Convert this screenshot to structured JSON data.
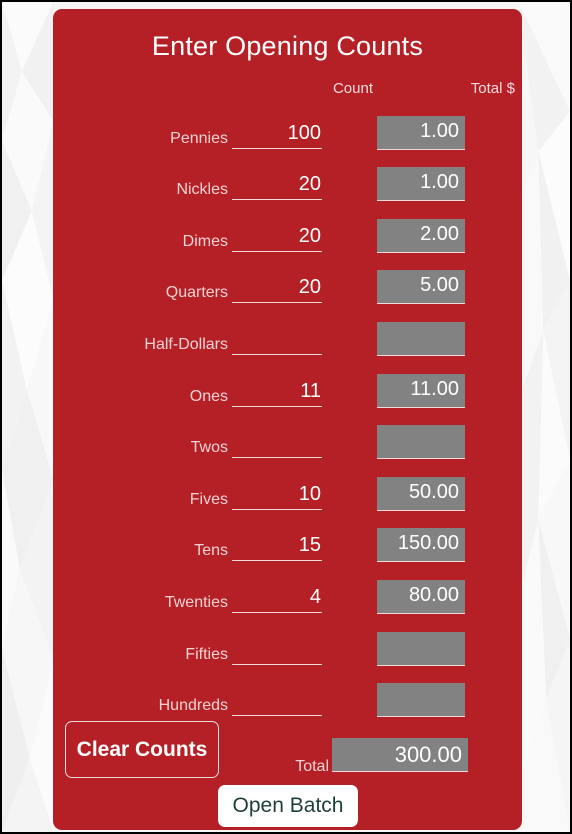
{
  "window": {
    "background_color": "#f7f7f7",
    "border_color": "#000000"
  },
  "card": {
    "background_color": "#b52026",
    "title": "Enter Opening Counts"
  },
  "headers": {
    "count": "Count",
    "total": "Total $"
  },
  "rows": [
    {
      "label": "Pennies",
      "count": "100",
      "total": "1.00"
    },
    {
      "label": "Nickles",
      "count": "20",
      "total": "1.00"
    },
    {
      "label": "Dimes",
      "count": "20",
      "total": "2.00"
    },
    {
      "label": "Quarters",
      "count": "20",
      "total": "5.00"
    },
    {
      "label": "Half-Dollars",
      "count": "",
      "total": ""
    },
    {
      "label": "Ones",
      "count": "11",
      "total": "11.00"
    },
    {
      "label": "Twos",
      "count": "",
      "total": ""
    },
    {
      "label": "Fives",
      "count": "10",
      "total": "50.00"
    },
    {
      "label": "Tens",
      "count": "15",
      "total": "150.00"
    },
    {
      "label": "Twenties",
      "count": "4",
      "total": "80.00"
    },
    {
      "label": "Fifties",
      "count": "",
      "total": ""
    },
    {
      "label": "Hundreds",
      "count": "",
      "total": ""
    }
  ],
  "footer": {
    "clear_button": "Clear Counts",
    "total_label": "Total",
    "grand_total": "300.00",
    "open_batch_button": "Open Batch"
  },
  "colors": {
    "card_red": "#b52026",
    "field_gray": "#828282",
    "text_white": "#ffffff",
    "label_pink": "#efd3d4",
    "open_batch_text": "#1f3d3a"
  }
}
